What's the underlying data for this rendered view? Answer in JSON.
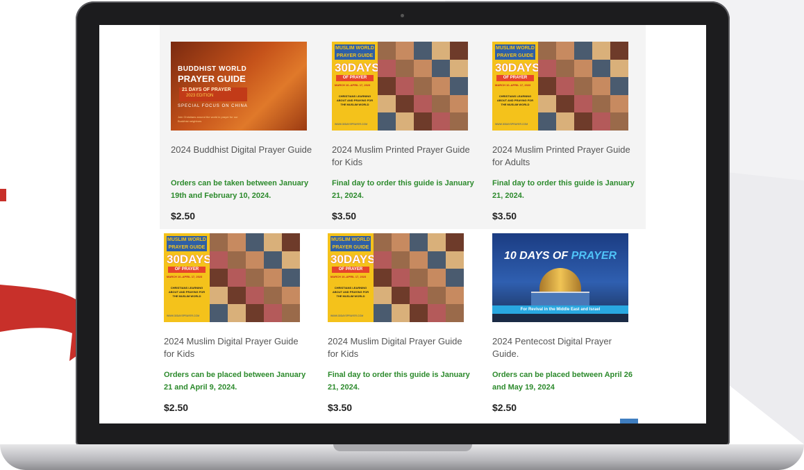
{
  "products": [
    {
      "image": "buddhist",
      "title": "2024 Buddhist Digital Prayer Guide",
      "note": "Orders can be taken between January 19th and February 10, 2024.",
      "price": "$2.50",
      "cover": {
        "line1": "BUDDHIST WORLD",
        "line2": "PRAYER GUIDE",
        "band1": "21 DAYS OF PRAYER",
        "band2": "2023 EDITION",
        "focus": "SPECIAL FOCUS ON CHINA",
        "small": "Join Christians around the world in prayer for our Buddhist neighbors"
      }
    },
    {
      "image": "muslim",
      "title": "2024 Muslim Printed Prayer Guide for Kids",
      "note": "Final day to order this guide is January 21, 2024.",
      "price": "$3.50"
    },
    {
      "image": "muslim",
      "title": "2024 Muslim Printed Prayer Guide for Adults",
      "note": "Final day to order this guide is January 21, 2024.",
      "price": "$3.50"
    },
    {
      "image": "muslim",
      "title": "2024 Muslim Digital Prayer Guide for Kids",
      "note": "Orders can be placed between January 21 and April 9, 2024.",
      "price": "$2.50"
    },
    {
      "image": "muslim",
      "title": "2024 Muslim Digital Prayer Guide for Kids",
      "note": "Final day to order this guide is January 21, 2024.",
      "price": "$3.50"
    },
    {
      "image": "pentecost",
      "title": "2024 Pentecost Digital Prayer Guide.",
      "note": "Orders can be placed between April 26 and May 19, 2024",
      "price": "$2.50",
      "cover": {
        "headline_a": "10 DAYS OF ",
        "headline_b": "PRAYER",
        "strip": "For Revival in the Middle East and Israel"
      }
    }
  ],
  "muslim_cover": {
    "header": "MUSLIM WORLD PRAYER GUIDE",
    "days": "30DAYS",
    "of_prayer": "OF PRAYER",
    "dates": "MARCH 10–APRIL 17, 2023",
    "blurb": "CHRISTIANS LEARNING ABOUT AND PRAYING FOR THE MUSLIM WORLD",
    "site": "WWW.30DAYSPRAYER.COM"
  },
  "colors": {
    "note_green": "#2c8a2c",
    "arrow_red": "#c8302a"
  }
}
